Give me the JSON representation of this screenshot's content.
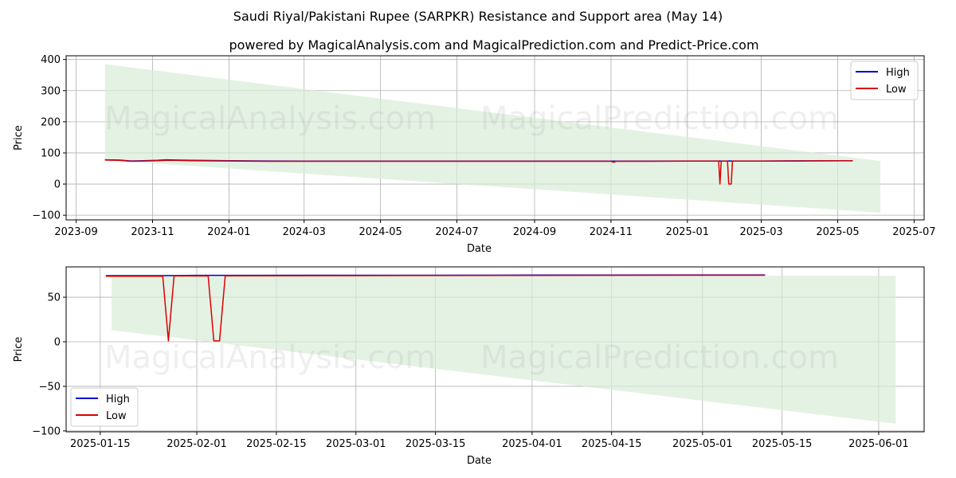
{
  "title_line1": "Saudi Riyal/Pakistani Rupee (SARPKR) Resistance and Support area (May 14)",
  "title_line2": "powered by MagicalAnalysis.com and MagicalPrediction.com and Predict-Price.com",
  "watermark_left": "MagicalAnalysis.com",
  "watermark_right": "MagicalPrediction.com",
  "colors": {
    "high": "#0000cc",
    "low": "#dd0000",
    "band": "#d8ecd8",
    "grid": "#b0b0b0"
  },
  "chart_data": [
    {
      "type": "line",
      "name": "full-history",
      "xlabel": "Date",
      "ylabel": "Price",
      "xlim": [
        "2023-08-24",
        "2025-07-09"
      ],
      "ylim": [
        -115,
        412
      ],
      "x_ticks": [
        "2023-09",
        "2023-11",
        "2024-01",
        "2024-03",
        "2024-05",
        "2024-07",
        "2024-09",
        "2024-11",
        "2025-01",
        "2025-03",
        "2025-05",
        "2025-07"
      ],
      "y_ticks": [
        400,
        300,
        200,
        100,
        0,
        -100
      ],
      "y_tick_labels": [
        "400",
        "300",
        "200",
        "100",
        "0",
        "−100"
      ],
      "grid": true,
      "legend": "upper right",
      "band": {
        "x": [
          "2023-09-24",
          "2025-06-04"
        ],
        "upper": [
          385,
          74
        ],
        "lower": [
          77,
          -92
        ]
      },
      "series": [
        {
          "name": "High",
          "x": [
            "2023-09-24",
            "2023-10-05",
            "2023-10-15",
            "2023-10-25",
            "2023-11-05",
            "2023-11-12",
            "2023-11-20",
            "2023-12-01",
            "2024-01-01",
            "2024-02-01",
            "2024-03-01",
            "2024-04-01",
            "2024-05-01",
            "2024-06-01",
            "2024-07-01",
            "2024-08-01",
            "2024-09-01",
            "2024-10-01",
            "2024-11-01",
            "2024-12-01",
            "2025-01-01",
            "2025-02-01",
            "2025-03-01",
            "2025-04-01",
            "2025-05-01",
            "2025-05-13"
          ],
          "y": [
            78,
            77,
            74,
            75,
            76,
            78,
            77,
            76,
            75,
            74,
            73.5,
            73.5,
            73.5,
            73.5,
            73.5,
            73.5,
            73.5,
            73.5,
            73.5,
            73.5,
            74,
            74,
            74,
            74.5,
            74.8,
            74.8
          ]
        },
        {
          "name": "Low",
          "x": [
            "2023-09-24",
            "2023-10-05",
            "2023-10-15",
            "2023-10-25",
            "2023-11-05",
            "2023-11-12",
            "2023-11-20",
            "2023-12-01",
            "2024-01-01",
            "2024-02-01",
            "2024-03-01",
            "2024-04-01",
            "2024-05-01",
            "2024-06-01",
            "2024-07-01",
            "2024-08-01",
            "2024-09-01",
            "2024-10-01",
            "2024-11-01",
            "2024-11-03",
            "2024-11-05",
            "2024-12-01",
            "2025-01-01",
            "2025-01-26",
            "2025-01-27",
            "2025-01-28",
            "2025-02-02",
            "2025-02-03",
            "2025-02-04",
            "2025-02-05",
            "2025-02-06",
            "2025-03-01",
            "2025-04-01",
            "2025-05-01",
            "2025-05-13"
          ],
          "y": [
            77,
            76,
            73,
            74,
            75,
            76,
            76,
            75,
            74,
            73,
            73,
            73,
            73,
            73,
            73,
            73,
            73,
            73,
            73,
            70,
            73,
            73,
            73.5,
            73.5,
            0,
            73.5,
            73.5,
            0,
            0,
            0,
            73.5,
            73.5,
            74,
            74.5,
            74.5
          ]
        }
      ]
    },
    {
      "type": "line",
      "name": "recent",
      "xlabel": "Date",
      "ylabel": "Price",
      "xlim": [
        "2025-01-09",
        "2025-06-09"
      ],
      "ylim": [
        -101,
        84
      ],
      "x_ticks": [
        "2025-01-15",
        "2025-02-01",
        "2025-02-15",
        "2025-03-01",
        "2025-03-15",
        "2025-04-01",
        "2025-04-15",
        "2025-05-01",
        "2025-05-15",
        "2025-06-01"
      ],
      "y_ticks": [
        50,
        0,
        -50,
        -100
      ],
      "y_tick_labels": [
        "50",
        "0",
        "−50",
        "−100"
      ],
      "grid": true,
      "legend": "lower left",
      "band": {
        "x": [
          "2025-01-17",
          "2025-06-04"
        ],
        "upper": [
          74,
          74
        ],
        "lower": [
          13,
          -92
        ]
      },
      "series": [
        {
          "name": "High",
          "x": [
            "2025-01-16",
            "2025-01-26",
            "2025-02-01",
            "2025-02-06",
            "2025-03-01",
            "2025-04-01",
            "2025-04-28",
            "2025-05-12"
          ],
          "y": [
            74.2,
            74.2,
            74.5,
            74.5,
            74.6,
            74.8,
            75,
            75
          ]
        },
        {
          "name": "Low",
          "x": [
            "2025-01-16",
            "2025-01-26",
            "2025-01-27",
            "2025-01-28",
            "2025-02-03",
            "2025-02-04",
            "2025-02-05",
            "2025-02-06",
            "2025-03-01",
            "2025-04-01",
            "2025-04-28",
            "2025-05-12"
          ],
          "y": [
            73.5,
            73.5,
            1,
            73.8,
            73.8,
            1,
            1,
            74,
            74.2,
            74.4,
            74.6,
            74.6
          ]
        }
      ]
    }
  ]
}
